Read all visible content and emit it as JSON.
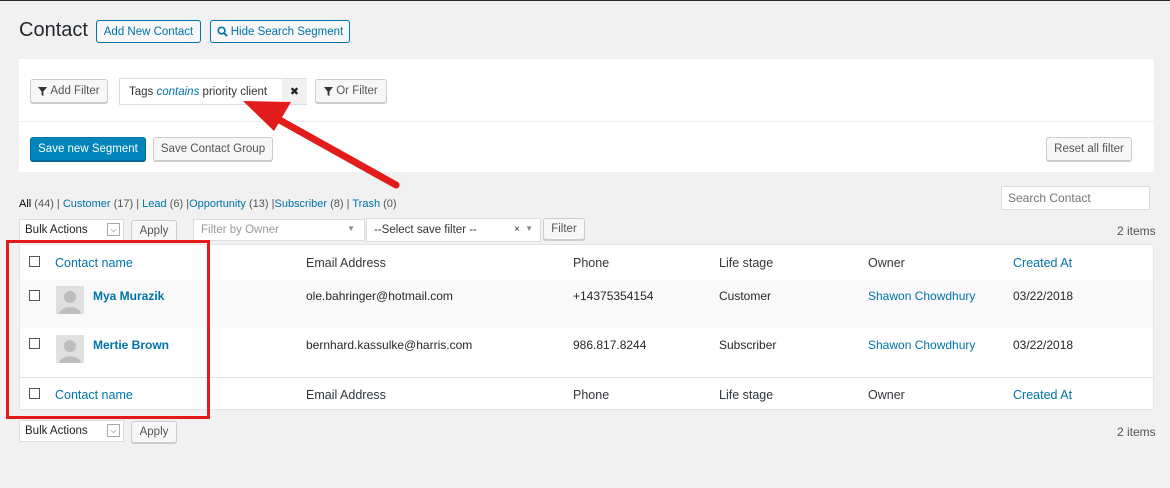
{
  "header": {
    "title": "Contact",
    "add_new_label": "Add New Contact",
    "hide_search_label": "Hide Search Segment"
  },
  "filter_panel": {
    "add_filter_label": "Add Filter",
    "filter_field": "Tags",
    "filter_operator": "contains",
    "filter_value": "priority client",
    "remove_label": "✖",
    "or_filter_label": "Or Filter",
    "save_segment_label": "Save new Segment",
    "save_group_label": "Save Contact Group",
    "reset_label": "Reset all filter"
  },
  "views": {
    "all": "All",
    "all_count": "(44)",
    "customer": "Customer",
    "customer_count": "(17)",
    "lead": "Lead",
    "lead_count": "(6)",
    "opportunity": "Opportunity",
    "opportunity_count": "(13)",
    "subscriber": "Subscriber",
    "subscriber_count": "(8)",
    "trash": "Trash",
    "trash_count": "(0)"
  },
  "search": {
    "placeholder": "Search Contact"
  },
  "tablenav_top": {
    "bulk_actions": "Bulk Actions",
    "apply": "Apply",
    "owner_placeholder": "Filter by Owner",
    "save_filter": "--Select save filter --",
    "filter_button": "Filter",
    "items_count": "2 items"
  },
  "table": {
    "columns": [
      "Contact name",
      "Email Address",
      "Phone",
      "Life stage",
      "Owner",
      "Created At"
    ],
    "rows": [
      {
        "name": "Mya Murazik",
        "email": "ole.bahringer@hotmail.com",
        "phone": "+14375354154",
        "life_stage": "Customer",
        "owner": "Shawon Chowdhury",
        "created": "03/22/2018"
      },
      {
        "name": "Mertie Brown",
        "email": "bernhard.kassulke@harris.com",
        "phone": "986.817.8244",
        "life_stage": "Subscriber",
        "owner": "Shawon Chowdhury",
        "created": "03/22/2018"
      }
    ]
  },
  "tablenav_bottom": {
    "bulk_actions": "Bulk Actions",
    "apply": "Apply",
    "items_count": "2 items"
  },
  "colors": {
    "link": "#0073aa",
    "primary": "#0085ba",
    "annotation": "#e21b1b",
    "background": "#f1f1f1"
  }
}
